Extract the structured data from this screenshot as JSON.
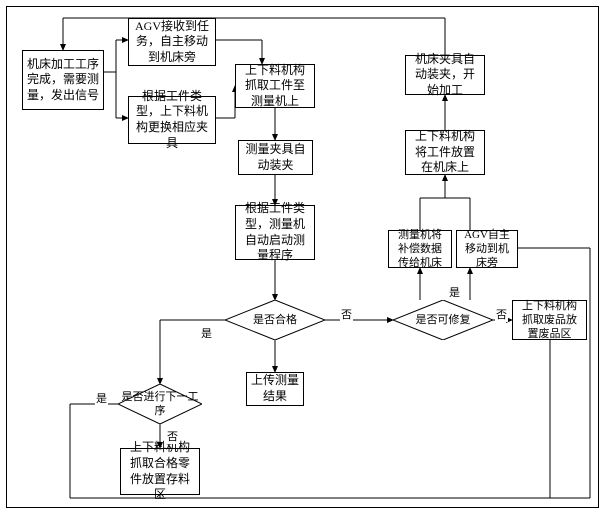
{
  "nodes": {
    "start": "机床加工工序完成，需要测量，发出信号",
    "agvTask": "AGV接收到任务，自主移动到机床旁",
    "changeFixture": "根据工件类型，上下料机构更换相应夹具",
    "pickToMeasure": "上下料机构抓取工件至测量机上",
    "clamp": "测量夹具自动装夹",
    "measureProgram": "根据工件类型，测量机自动启动测量程序",
    "upload": "上传测量结果",
    "scrap": "上下料机构抓取废品放置废品区",
    "compensate": "测量机将补偿数据传给机床",
    "agvMove2": "AGV自主移动到机床旁",
    "placeMachine": "上下料机构将工件放置在机床上",
    "clamp2": "机床夹具自动装夹，开始加工",
    "store": "上下料机构抓取合格零件放置存料区"
  },
  "decisions": {
    "qualified": "是否合格",
    "nextProc": "是否进行下一工序",
    "repairable": "是否可修复"
  },
  "labels": {
    "yes": "是",
    "no": "否"
  },
  "chart_data": {
    "type": "flowchart",
    "title": "",
    "nodes": [
      {
        "id": "start",
        "type": "process",
        "text": "机床加工工序完成，需要测量，发出信号"
      },
      {
        "id": "agvTask",
        "type": "process",
        "text": "AGV接收到任务，自主移动到机床旁"
      },
      {
        "id": "changeFixture",
        "type": "process",
        "text": "根据工件类型，上下料机构更换相应夹具"
      },
      {
        "id": "pickToMeasure",
        "type": "process",
        "text": "上下料机构抓取工件至测量机上"
      },
      {
        "id": "clamp",
        "type": "process",
        "text": "测量夹具自动装夹"
      },
      {
        "id": "measureProgram",
        "type": "process",
        "text": "根据工件类型，测量机自动启动测量程序"
      },
      {
        "id": "qualified",
        "type": "decision",
        "text": "是否合格"
      },
      {
        "id": "nextProc",
        "type": "decision",
        "text": "是否进行下一工序"
      },
      {
        "id": "upload",
        "type": "process",
        "text": "上传测量结果"
      },
      {
        "id": "repairable",
        "type": "decision",
        "text": "是否可修复"
      },
      {
        "id": "compensate",
        "type": "process",
        "text": "测量机将补偿数据传给机床"
      },
      {
        "id": "agvMove2",
        "type": "process",
        "text": "AGV自主移动到机床旁"
      },
      {
        "id": "placeMachine",
        "type": "process",
        "text": "上下料机构将工件放置在机床上"
      },
      {
        "id": "clamp2",
        "type": "process",
        "text": "机床夹具自动装夹，开始加工"
      },
      {
        "id": "scrap",
        "type": "process",
        "text": "上下料机构抓取废品放置废品区"
      },
      {
        "id": "store",
        "type": "process",
        "text": "上下料机构抓取合格零件放置存料区"
      }
    ],
    "edges": [
      {
        "from": "start",
        "to": "agvTask"
      },
      {
        "from": "start",
        "to": "changeFixture"
      },
      {
        "from": "agvTask",
        "to": "pickToMeasure"
      },
      {
        "from": "changeFixture",
        "to": "pickToMeasure"
      },
      {
        "from": "pickToMeasure",
        "to": "clamp"
      },
      {
        "from": "clamp",
        "to": "measureProgram"
      },
      {
        "from": "measureProgram",
        "to": "qualified"
      },
      {
        "from": "qualified",
        "to": "nextProc",
        "label": "是"
      },
      {
        "from": "qualified",
        "to": "upload",
        "label": "否",
        "note": "also branches to repairable"
      },
      {
        "from": "qualified",
        "to": "repairable",
        "label": "否"
      },
      {
        "from": "nextProc",
        "to": "agvMove2",
        "label": "是"
      },
      {
        "from": "nextProc",
        "to": "store",
        "label": "否"
      },
      {
        "from": "repairable",
        "to": "compensate",
        "label": "是"
      },
      {
        "from": "repairable",
        "to": "agvMove2",
        "label": "是"
      },
      {
        "from": "repairable",
        "to": "scrap",
        "label": "否"
      },
      {
        "from": "compensate",
        "to": "placeMachine"
      },
      {
        "from": "agvMove2",
        "to": "placeMachine"
      },
      {
        "from": "placeMachine",
        "to": "clamp2"
      },
      {
        "from": "clamp2",
        "to": "start"
      },
      {
        "from": "scrap",
        "to": "start",
        "note": "loop back"
      },
      {
        "from": "store",
        "to": "start",
        "note": "loop back"
      }
    ]
  }
}
